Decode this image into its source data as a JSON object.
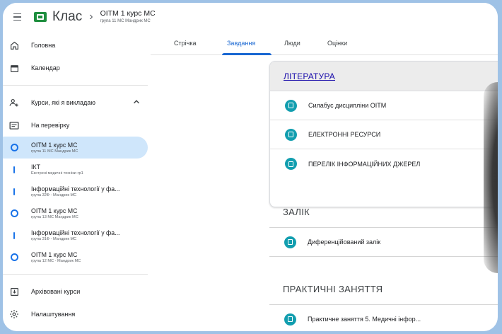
{
  "topbar": {
    "app_title": "Клас",
    "separator": "›",
    "course_title": "ОІТМ 1 курс МС",
    "course_subtitle": "група 11 МС Мандрик МС"
  },
  "sidebar": {
    "home": "Головна",
    "calendar": "Календар",
    "teaching": "Курси, які я викладаю",
    "to_review": "На перевірку",
    "courses": [
      {
        "name": "ОІТМ 1 курс МС",
        "sub": "група 11 МС Мандрик МС",
        "active": true,
        "icon": "circle"
      },
      {
        "name": "ІКТ",
        "sub": "Екстрені медичні техніки гр1",
        "active": false,
        "icon": "bar"
      },
      {
        "name": "Інформаційні технології у фа...",
        "sub": "група 32Ф - Мандрик МС",
        "active": false,
        "icon": "bar"
      },
      {
        "name": "ОІТМ 1 курс МС",
        "sub": "група 13 МС Мандрик МС",
        "active": false,
        "icon": "circle"
      },
      {
        "name": "Інформаційні технології у фа...",
        "sub": "група 31Ф - Мандрик МС",
        "active": false,
        "icon": "bar"
      },
      {
        "name": "ОІТМ 1 курс МС",
        "sub": "група 12 МС - Мандрик МС",
        "active": false,
        "icon": "circle"
      }
    ],
    "archived": "Архівовані курси",
    "settings": "Налаштування"
  },
  "tabs": {
    "stream": "Стрічка",
    "classwork": "Завдання",
    "people": "Люди",
    "grades": "Оцінки"
  },
  "main": {
    "literature_title": "ЛІТЕРАТУРА",
    "literature_items": [
      "Силабус дисципліни ОІТМ",
      "ЕЛЕКТРОННІ РЕСУРСИ",
      "ПЕРЕЛІК ІНФОРМАЦІЙНИХ ДЖЕРЕЛ"
    ],
    "credit_title": "ЗАЛІК",
    "credit_item": "Диференційований залік",
    "practice_title": "ПРАКТИЧНІ ЗАНЯТТЯ",
    "practice_item": "Практичне заняття 5. Медичні інфор..."
  },
  "colors": {
    "accent": "#1967d2",
    "active_bg": "#cfe6fb",
    "material_icon": "#129eaf",
    "frame_bg": "#9fc2e6"
  }
}
